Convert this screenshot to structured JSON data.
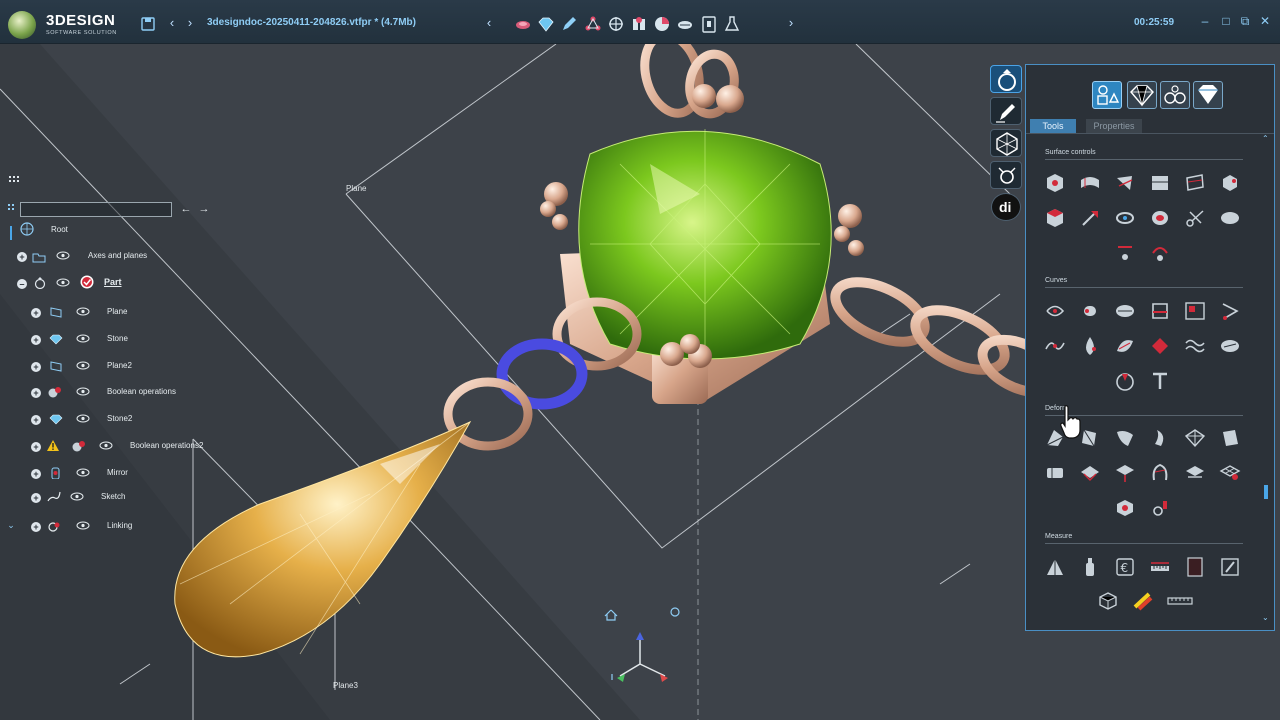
{
  "app": {
    "logo_name": "3DESIGN",
    "logo_sub": "SOFTWARE SOLUTION",
    "document_title": "3designdoc-20250411-204826.vtfpr * (4.7Mb)",
    "timer": "00:25:59"
  },
  "toolbar": {
    "icons": [
      "save-icon",
      "back-icon",
      "forward-icon",
      "prev-icon",
      "stone-tool-icon",
      "gem-icon",
      "pen-icon",
      "network-icon",
      "transform-icon",
      "render-icon",
      "cut-icon",
      "lock-icon",
      "flask-icon",
      "next-icon"
    ]
  },
  "tree": {
    "root_label": "Root",
    "items": [
      {
        "label": "Axes and planes",
        "icon": "folder-icon"
      },
      {
        "label": "Part",
        "icon": "ring-icon",
        "selected": true
      },
      {
        "label": "Plane",
        "icon": "plane-icon"
      },
      {
        "label": "Stone",
        "icon": "gem-icon"
      },
      {
        "label": "Plane2",
        "icon": "plane-icon"
      },
      {
        "label": "Boolean operations",
        "icon": "boolean-icon"
      },
      {
        "label": "Stone2",
        "icon": "gem-icon"
      },
      {
        "label": "Boolean operations2",
        "icon": "boolean-icon",
        "warning": true
      },
      {
        "label": "Mirror",
        "icon": "mirror-icon"
      },
      {
        "label": "Sketch",
        "icon": "sketch-icon"
      },
      {
        "label": "Linking",
        "icon": "linking-icon"
      }
    ]
  },
  "viewport": {
    "label_plane": "Plane",
    "label_plane3": "Plane3",
    "colors": {
      "gem_green": "#7cc81e",
      "gem_gold": "#d9a63c",
      "metal": "#e8b9a2",
      "link_blue": "#4a4be0"
    }
  },
  "panel": {
    "tab_tools": "Tools",
    "tab_properties": "Properties",
    "sections": {
      "surface": "Surface controls",
      "curves": "Curves",
      "deform": "Deform",
      "measure": "Measure"
    }
  }
}
